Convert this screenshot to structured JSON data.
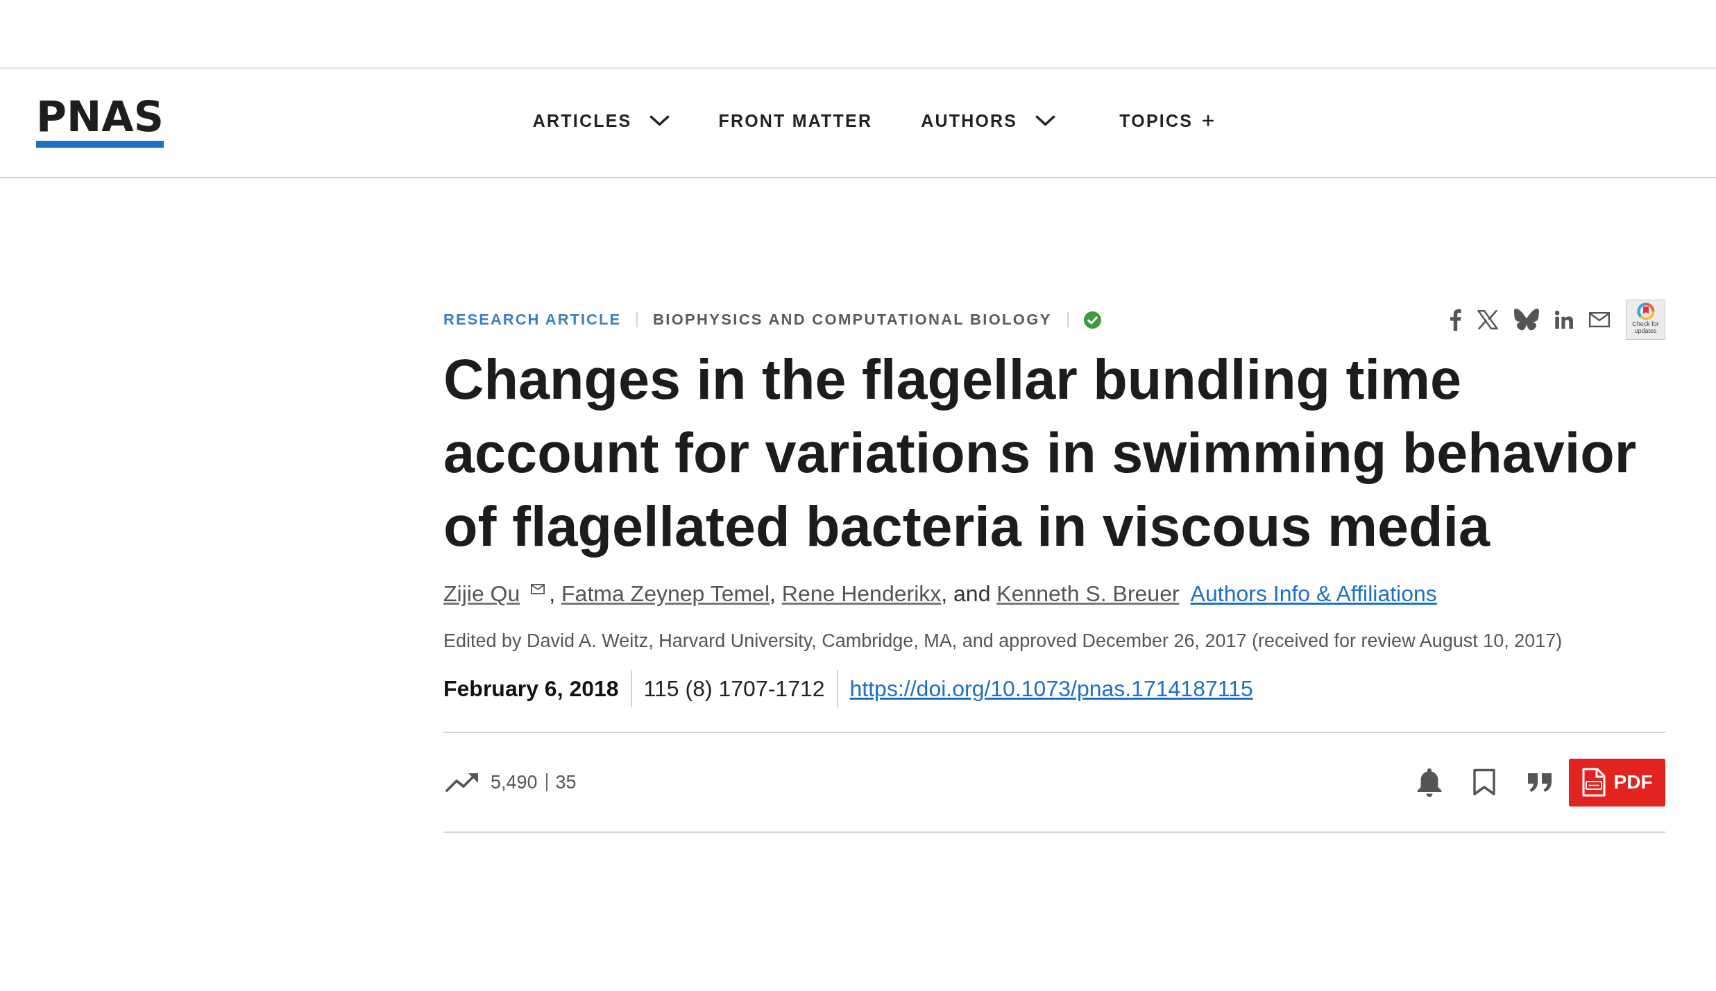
{
  "header": {
    "logo": "PNAS",
    "nav": [
      {
        "label": "ARTICLES",
        "kind": "dropdown"
      },
      {
        "label": "FRONT MATTER",
        "kind": "link"
      },
      {
        "label": "AUTHORS",
        "kind": "dropdown"
      },
      {
        "label": "TOPICS",
        "kind": "expand"
      }
    ]
  },
  "article": {
    "article_type": "RESEARCH ARTICLE",
    "section": "BIOPHYSICS AND COMPUTATIONAL BIOLOGY",
    "check_updates_label": "Check for updates",
    "title": "Changes in the flagellar bundling time account for variations in swimming behavior of flagellated bacteria in viscous media",
    "authors": [
      {
        "name": "Zijie Qu",
        "corresponding": true,
        "separator": ","
      },
      {
        "name": "Fatma Zeynep Temel",
        "corresponding": false,
        "separator": ","
      },
      {
        "name": "Rene Henderikx",
        "corresponding": false,
        "separator": ", and"
      },
      {
        "name": "Kenneth S. Breuer",
        "corresponding": false
      }
    ],
    "affiliations_link": "Authors Info & Affiliations",
    "edited_by": "Edited by David A. Weitz, Harvard University, Cambridge, MA, and approved December 26, 2017 (received for review August 10, 2017)",
    "date": "February 6, 2018",
    "citation": "115 (8) 1707-1712",
    "doi": "https://doi.org/10.1073/pnas.1714187115",
    "metrics": {
      "views": "5,490",
      "citations": "35"
    },
    "pdf_button": "PDF"
  }
}
